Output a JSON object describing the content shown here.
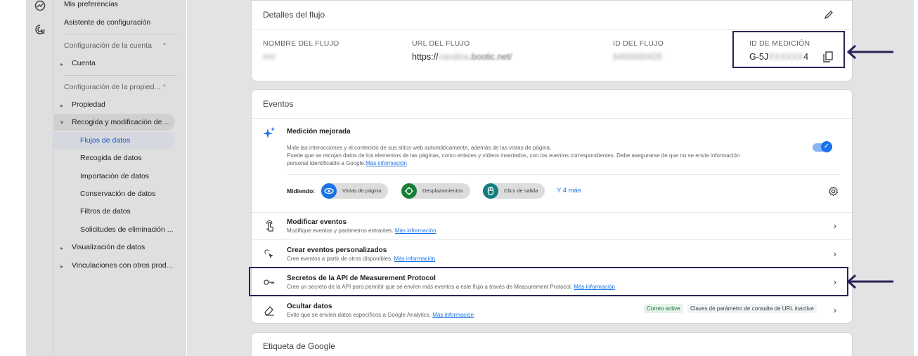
{
  "nav": {
    "items_top": [
      "Mis preferencias",
      "Asistente de configuración"
    ],
    "section_account": "Configuración de la cuenta",
    "account_items": [
      "Cuenta"
    ],
    "section_property": "Configuración de la propied...",
    "property_items": [
      "Propiedad",
      "Recogida y modificación de ..."
    ],
    "collection_subitems": [
      "Flujos de datos",
      "Recogida de datos",
      "Importación de datos",
      "Conservación de datos",
      "Filtros de datos",
      "Solicitudes de eliminación ..."
    ],
    "more_items": [
      "Visualización de datos",
      "Vinculaciones con otros prod..."
    ]
  },
  "stream_details": {
    "title": "Detalles del flujo",
    "name_label": "NOMBRE DEL FLUJO",
    "name_value": "test",
    "url_label": "URL DEL FLUJO",
    "url_prefix": "https://",
    "url_blurred": "carolina",
    "url_suffix": ".bootic.net/",
    "id_label": "ID DEL FLUJO",
    "id_value": "6400060428",
    "measurement_label": "ID DE MEDICIÓN",
    "measurement_prefix": "G-5J",
    "measurement_blurred": "XXXXXX",
    "measurement_suffix": "4"
  },
  "events": {
    "title": "Eventos",
    "enhanced_title": "Medición mejorada",
    "enhanced_desc_1": "Mide las interacciones y el contenido de sus sitios web automáticamente, además de las vistas de página.",
    "enhanced_desc_2": "Puede que se recojan datos de los elementos de las páginas, como enlaces y vídeos insertados, con los eventos correspondientes. Debe asegurarse de que no se envíe información",
    "enhanced_desc_3": "personal identificable a Google.",
    "more_info": "Más información",
    "measuring_label": "Midiendo:",
    "chips": [
      "Vistas de página",
      "Desplazamientos",
      "Clics de salida"
    ],
    "more_chips": "Y 4 más",
    "rows": [
      {
        "title": "Modificar eventos",
        "desc": "Modifique eventos y parámetros entrantes."
      },
      {
        "title": "Crear eventos personalizados",
        "desc": "Cree eventos a partir de otros disponibles."
      },
      {
        "title": "Secretos de la API de Measurement Protocol",
        "desc": "Cree un secreto de la API para permitir que se envíen más eventos a este flujo a través de Measurement Protocol."
      },
      {
        "title": "Ocultar datos",
        "desc": "Evite que se envíen datos específicos a Google Analytics."
      }
    ],
    "badge_email": "Correo active",
    "badge_url": "Claves de parámetro de consulta de URL inactive"
  },
  "google_tag": {
    "title": "Etiqueta de Google"
  },
  "colors": {
    "accent": "#1a73e8",
    "highlight": "#2a2254",
    "chip_blue": "#1a73e8",
    "chip_green": "#188038",
    "chip_teal": "#137c7c"
  },
  "icons": [
    "insights-icon",
    "target-icon",
    "pencil-icon",
    "copy-icon",
    "sparkle-icon",
    "settings-icon",
    "touch-icon",
    "cursor-click-icon",
    "key-icon",
    "eraser-icon",
    "chevron-right-icon",
    "arrow-left-icon"
  ]
}
